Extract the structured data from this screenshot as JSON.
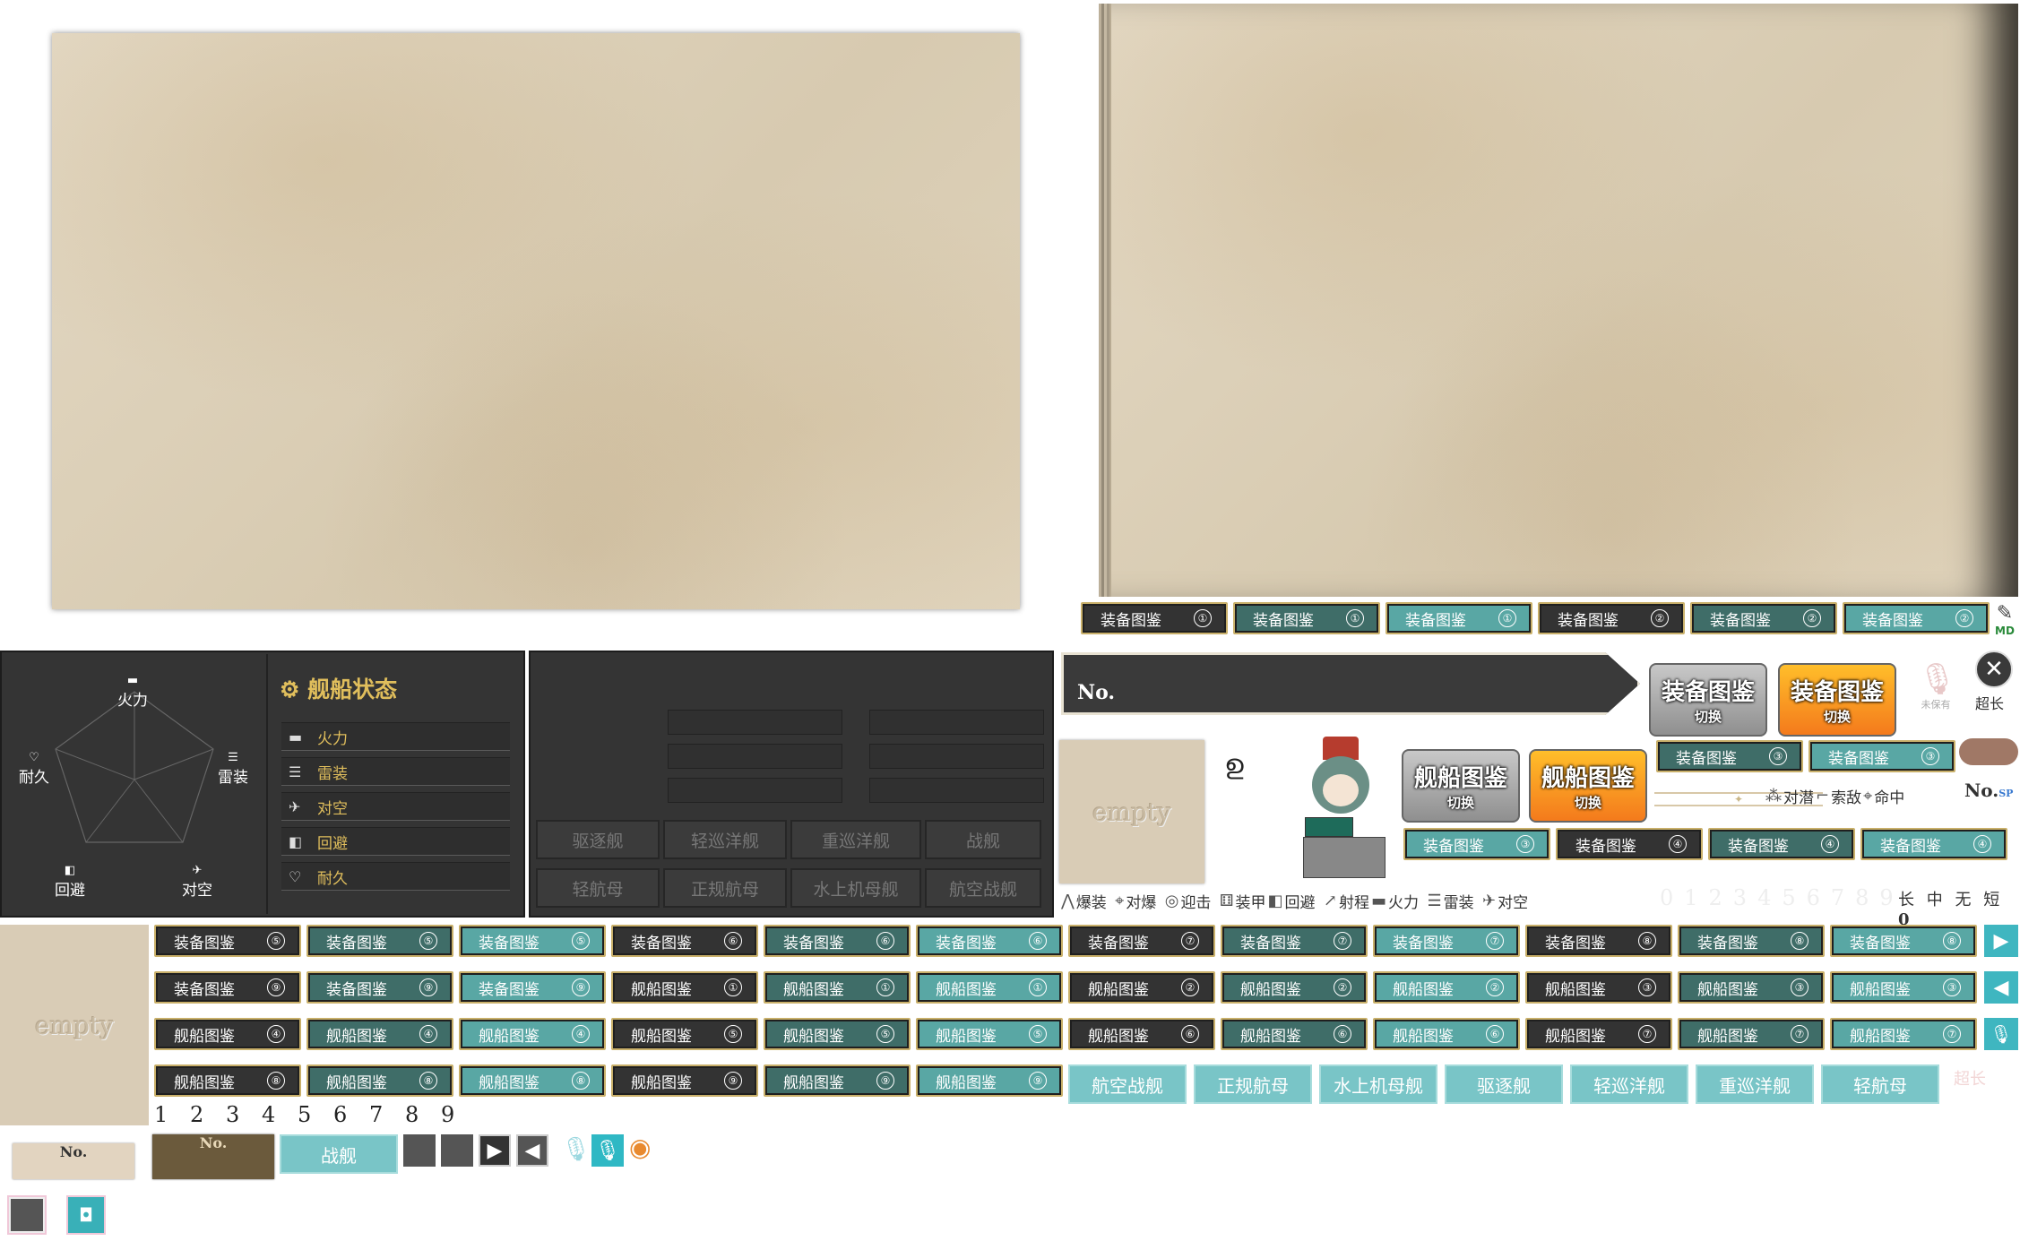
{
  "equip_label": "装备图鉴",
  "ship_label": "舰船图鉴",
  "top_buttons": [
    {
      "label": "装备图鉴",
      "num": "①",
      "v": "d"
    },
    {
      "label": "装备图鉴",
      "num": "①",
      "v": "g"
    },
    {
      "label": "装备图鉴",
      "num": "①",
      "v": "l"
    },
    {
      "label": "装备图鉴",
      "num": "②",
      "v": "d"
    },
    {
      "label": "装备图鉴",
      "num": "②",
      "v": "g"
    },
    {
      "label": "装备图鉴",
      "num": "②",
      "v": "l"
    }
  ],
  "mid_buttons_row1": [
    {
      "label": "装备图鉴",
      "num": "③",
      "v": "g"
    },
    {
      "label": "装备图鉴",
      "num": "③",
      "v": "l"
    }
  ],
  "mid_buttons_row2": [
    {
      "label": "装备图鉴",
      "num": "③",
      "v": "l"
    },
    {
      "label": "装备图鉴",
      "num": "④",
      "v": "d"
    },
    {
      "label": "装备图鉴",
      "num": "④",
      "v": "g"
    },
    {
      "label": "装备图鉴",
      "num": "④",
      "v": "l"
    }
  ],
  "grid_row1": [
    "⑤",
    "⑤",
    "⑤",
    "⑥",
    "⑥",
    "⑥",
    "⑦",
    "⑦",
    "⑦",
    "⑧",
    "⑧",
    "⑧"
  ],
  "grid_row2": [
    {
      "label": "装备图鉴",
      "num": "⑨"
    },
    {
      "label": "装备图鉴",
      "num": "⑨"
    },
    {
      "label": "装备图鉴",
      "num": "⑨"
    },
    {
      "label": "舰船图鉴",
      "num": "①"
    },
    {
      "label": "舰船图鉴",
      "num": "①"
    },
    {
      "label": "舰船图鉴",
      "num": "①"
    },
    {
      "label": "舰船图鉴",
      "num": "②"
    },
    {
      "label": "舰船图鉴",
      "num": "②"
    },
    {
      "label": "舰船图鉴",
      "num": "②"
    },
    {
      "label": "舰船图鉴",
      "num": "③"
    },
    {
      "label": "舰船图鉴",
      "num": "③"
    },
    {
      "label": "舰船图鉴",
      "num": "③"
    }
  ],
  "grid_row3": [
    "④",
    "④",
    "④",
    "⑤",
    "⑤",
    "⑤",
    "⑥",
    "⑥",
    "⑥",
    "⑦",
    "⑦",
    "⑦"
  ],
  "grid_row4": [
    "⑧",
    "⑧",
    "⑧",
    "⑨",
    "⑨",
    "⑨"
  ],
  "type_tabs": [
    "航空战舰",
    "正规航母",
    "水上机母舰",
    "驱逐舰",
    "轻巡洋舰",
    "重巡洋舰",
    "轻航母"
  ],
  "status_panel": {
    "title": "舰船状态",
    "stats": [
      "火力",
      "雷装",
      "对空",
      "回避",
      "耐久"
    ]
  },
  "radar": {
    "labels": [
      "火力",
      "雷装",
      "对空",
      "回避",
      "耐久"
    ]
  },
  "type_panel": {
    "cells": [
      "驱逐舰",
      "轻巡洋舰",
      "重巡洋舰",
      "战舰",
      "轻航母",
      "正规航母",
      "水上机母舰",
      "航空战舰"
    ]
  },
  "banner": {
    "no": "No."
  },
  "switch_buttons": [
    {
      "title": "装备图鉴",
      "sub": "切换"
    },
    {
      "title": "装备图鉴",
      "sub": "切换"
    },
    {
      "title": "舰船图鉴",
      "sub": "切换"
    },
    {
      "title": "舰船图鉴",
      "sub": "切换"
    }
  ],
  "close": {
    "label": "超长"
  },
  "mic_caption": "未保有",
  "md_label": "MD",
  "empty_label": "empty",
  "no_label": "No.",
  "no_sp": "SP",
  "stat_legend": [
    "爆装",
    "对爆",
    "迎击",
    "装甲",
    "回避",
    "射程",
    "火力",
    "雷装",
    "对空"
  ],
  "legend_right": [
    "对潜",
    "索敌",
    "命中"
  ],
  "range_labels": [
    "长",
    "中",
    "无",
    "短",
    "0"
  ],
  "faded_digits": "0123456789",
  "page_numbers": [
    "1",
    "2",
    "3",
    "4",
    "5",
    "6",
    "7",
    "8",
    "9"
  ],
  "tag_label": "战舰",
  "ne_small": "超长"
}
